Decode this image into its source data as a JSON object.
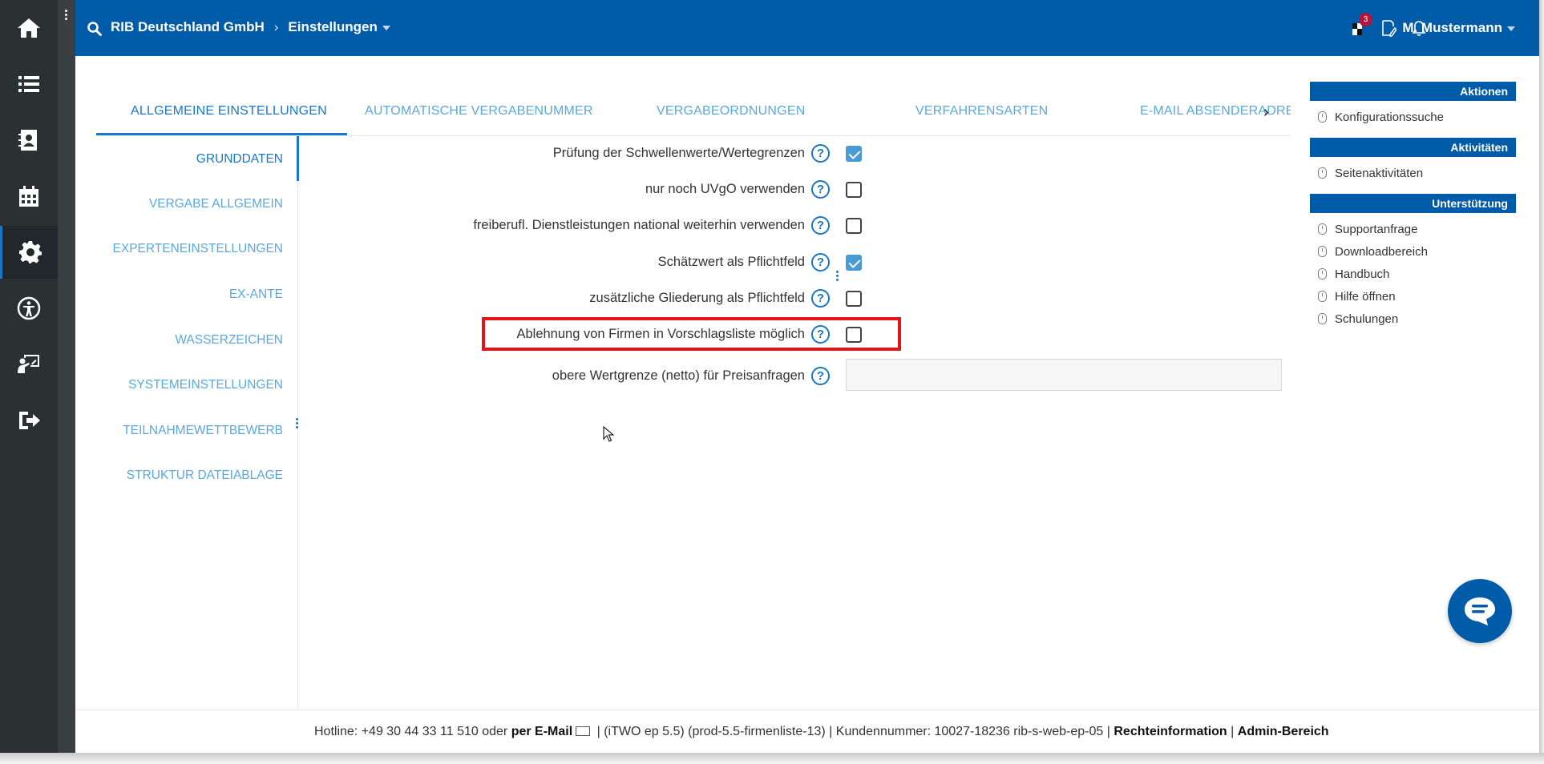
{
  "header": {
    "company": "RIB Deutschland GmbH",
    "section": "Einstellungen",
    "notification_count": "3",
    "user": "M. Mustermann"
  },
  "tabs": [
    {
      "label": "ALLGEMEINE EINSTELLUNGEN"
    },
    {
      "label": "AUTOMATISCHE VERGABENUMMER"
    },
    {
      "label": "VERGABEORDNUNGEN"
    },
    {
      "label": "VERFAHRENSARTEN"
    },
    {
      "label": "E-MAIL ABSENDERADRES"
    }
  ],
  "subnav": [
    {
      "label": "GRUNDDATEN"
    },
    {
      "label": "VERGABE ALLGEMEIN"
    },
    {
      "label": "EXPERTENEINSTELLUNGEN"
    },
    {
      "label": "EX-ANTE"
    },
    {
      "label": "WASSERZEICHEN"
    },
    {
      "label": "SYSTEMEINSTELLUNGEN"
    },
    {
      "label": "TEILNAHMEWETTBEWERB"
    },
    {
      "label": "STRUKTUR DATEIABLAGE"
    }
  ],
  "settings": [
    {
      "label": "Prüfung der Schwellenwerte/Wertegrenzen",
      "checked": true
    },
    {
      "label": "nur noch UVgO verwenden",
      "checked": false
    },
    {
      "label": "freiberufl. Dienstleistungen national weiterhin verwenden",
      "checked": false
    },
    {
      "label": "Schätzwert als Pflichtfeld",
      "checked": true
    },
    {
      "label": "zusätzliche Gliederung als Pflichtfeld",
      "checked": false
    },
    {
      "label": "Ablehnung von Firmen in Vorschlagsliste möglich",
      "checked": false
    },
    {
      "label": "obere Wertgrenze (netto) für Preisanfragen",
      "value": ""
    }
  ],
  "help_glyph": "?",
  "right_panel": {
    "aktionen": {
      "title": "Aktionen",
      "items": [
        "Konfigurationssuche"
      ]
    },
    "aktivitaeten": {
      "title": "Aktivitäten",
      "items": [
        "Seitenaktivitäten"
      ]
    },
    "unterstuetzung": {
      "title": "Unterstützung",
      "items": [
        "Supportanfrage",
        "Downloadbereich",
        "Handbuch",
        "Hilfe öffnen",
        "Schulungen"
      ]
    }
  },
  "footer": {
    "hotline": "Hotline: +49 30 44 33 11 510 oder",
    "email": "per E-Mail",
    "version": "|  (iTWO ep 5.5) (prod-5.5-firmenliste-13)  |  Kundennummer: 10027-18236 rib-s-web-ep-05 |",
    "legal": "Rechteinformation",
    "sep": "|",
    "admin": "Admin-Bereich"
  },
  "colors": {
    "brand_blue": "#005ba8",
    "accent_blue": "#1a77c8",
    "highlight_red": "#e3151a"
  }
}
